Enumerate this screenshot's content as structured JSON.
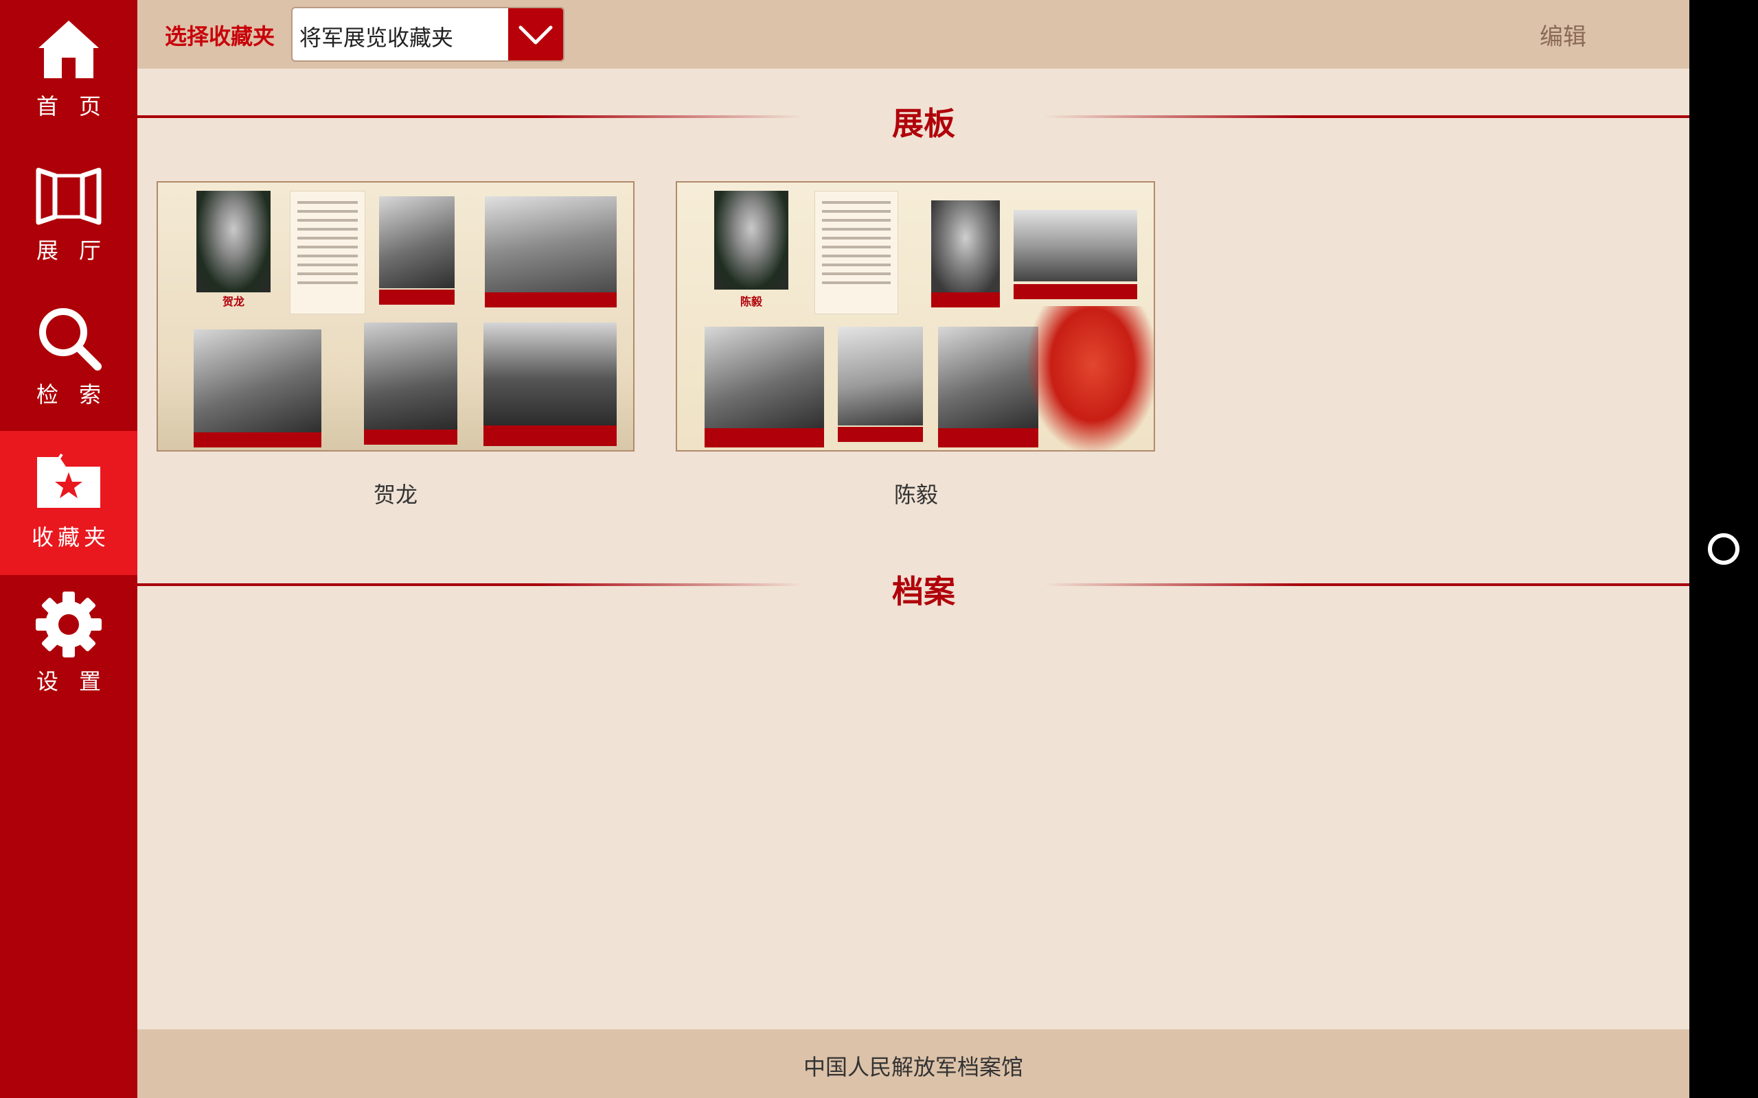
{
  "sidebar": {
    "items": [
      {
        "label": "首页",
        "icon": "home-icon"
      },
      {
        "label": "展厅",
        "icon": "hall-icon"
      },
      {
        "label": "检索",
        "icon": "search-icon"
      },
      {
        "label": "收藏夹",
        "icon": "favorites-icon",
        "active": true
      },
      {
        "label": "设置",
        "icon": "gear-icon"
      }
    ]
  },
  "topbar": {
    "select_label": "选择收藏夹",
    "selected_folder": "将军展览收藏夹",
    "edit_label": "编辑"
  },
  "sections": {
    "boards_title": "展板",
    "archives_title": "档案"
  },
  "boards": [
    {
      "name": "贺龙",
      "poster_name": "贺龙"
    },
    {
      "name": "陈毅",
      "poster_name": "陈毅"
    }
  ],
  "footer": {
    "text": "中国人民解放军档案馆"
  },
  "colors": {
    "sidebar": "#ae0008",
    "sidebar_active": "#e9171e",
    "accent_red": "#b0000a",
    "bar_beige": "#dcc2a9",
    "background": "#f0e2d5"
  }
}
